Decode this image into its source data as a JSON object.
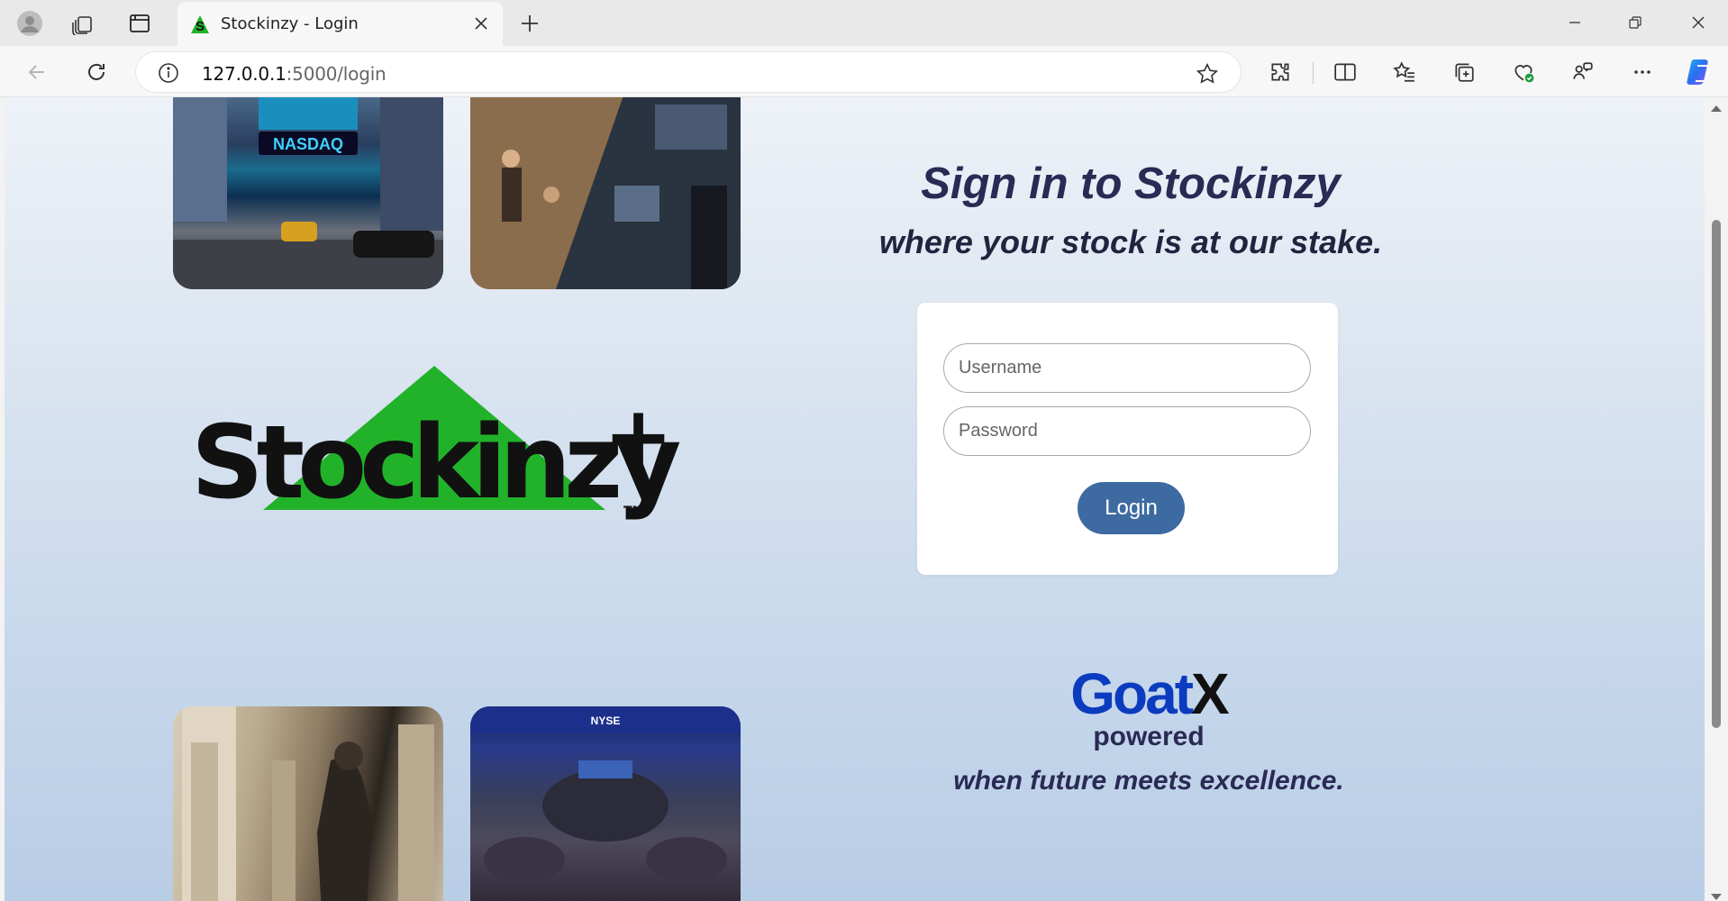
{
  "browser": {
    "tab": {
      "title": "Stockinzy - Login",
      "favicon": "stockinzy-favicon"
    },
    "address": {
      "host": "127.0.0.1",
      "rest": ":5000/login"
    }
  },
  "page": {
    "headline": "Sign in to Stockinzy",
    "subheadline": "where your stock is at our stake.",
    "logo": {
      "brand": "Stockinzy",
      "plus": "+",
      "tm": "TM",
      "triangle_color": "#22b22a"
    },
    "form": {
      "username_placeholder": "Username",
      "password_placeholder": "Password",
      "login_label": "Login",
      "button_color": "#3d6aa1"
    },
    "powered": {
      "logo_goat": "Goat",
      "logo_x": "X",
      "powered_label": "powered",
      "tagline": "when future meets excellence."
    },
    "photos": [
      "nasdaq-times-square-photo",
      "trading-floor-split-photo",
      "federal-hall-statue-photo",
      "nyse-floor-photo"
    ]
  },
  "colors": {
    "heading": "#2a2a54",
    "goatx_blue": "#0b3bbf"
  }
}
